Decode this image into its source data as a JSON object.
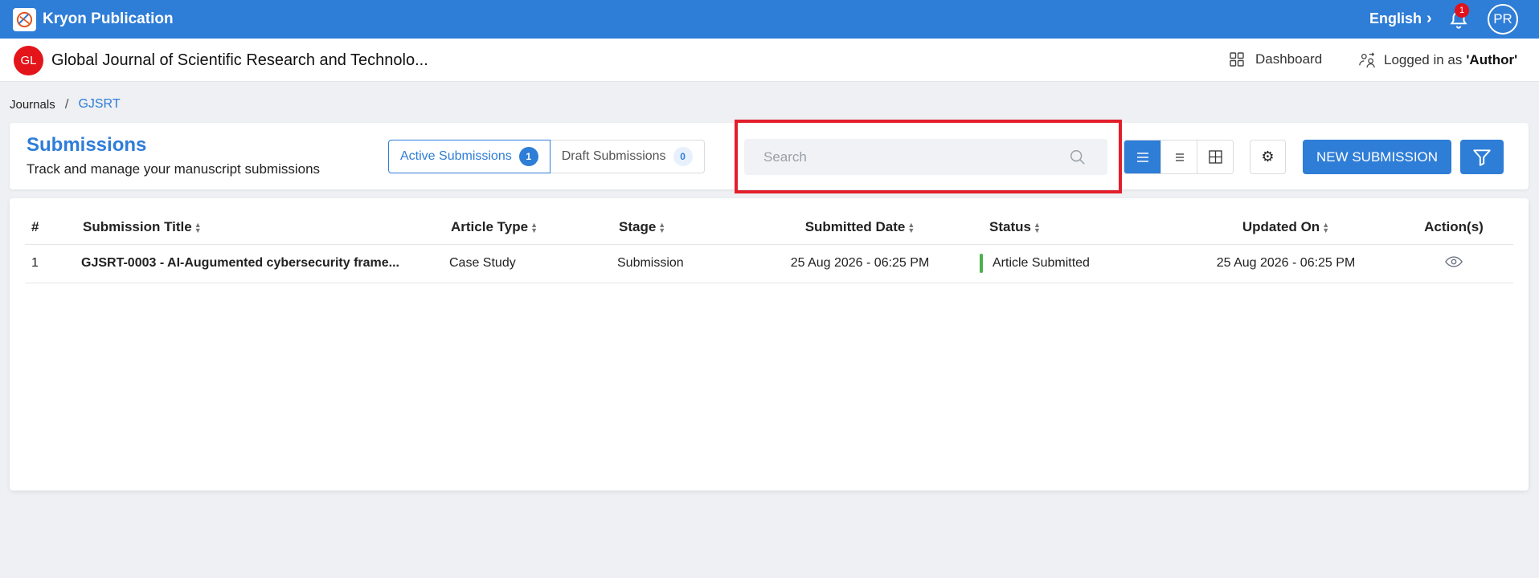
{
  "topbar": {
    "brand": "Kryon Publication",
    "language": "English",
    "notification_count": "1",
    "user_initials": "PR"
  },
  "journal": {
    "badge": "GL",
    "title": "Global Journal of Scientific Research and Technolo...",
    "dashboard_label": "Dashboard",
    "logged_prefix": "Logged in as",
    "logged_role": "'Author'"
  },
  "breadcrumb": {
    "parent": "Journals",
    "separator": "/",
    "current": "GJSRT"
  },
  "header": {
    "title": "Submissions",
    "subtitle": "Track and manage your manuscript submissions",
    "tabs": [
      {
        "label": "Active Submissions",
        "count": "1"
      },
      {
        "label": "Draft Submissions",
        "count": "0"
      }
    ],
    "search_placeholder": "Search",
    "settings_glyph": "⚙",
    "new_submission_label": "NEW SUBMISSION"
  },
  "table": {
    "columns": [
      "#",
      "Submission Title",
      "Article Type",
      "Stage",
      "Submitted Date",
      "Status",
      "Updated On",
      "Action(s)"
    ],
    "rows": [
      {
        "num": "1",
        "title": "GJSRT-0003 - AI-Augumented cybersecurity frame...",
        "type": "Case Study",
        "stage": "Submission",
        "submitted": "25 Aug 2026 - 06:25 PM",
        "status": "Article Submitted",
        "updated": "25 Aug 2026 - 06:25 PM"
      }
    ]
  },
  "colors": {
    "primary": "#2e7dd7",
    "status_submitted": "#4caf50",
    "highlight": "#e31e2b",
    "badge_red": "#e3151b"
  },
  "icons": [
    "brand-logo-icon",
    "chevron-right-icon",
    "bell-icon",
    "dashboard-grid-icon",
    "users-switch-icon",
    "search-icon",
    "list-view-icon",
    "compact-list-icon",
    "grid-view-icon",
    "settings-icon",
    "filter-icon",
    "sort-icon",
    "eye-icon"
  ]
}
